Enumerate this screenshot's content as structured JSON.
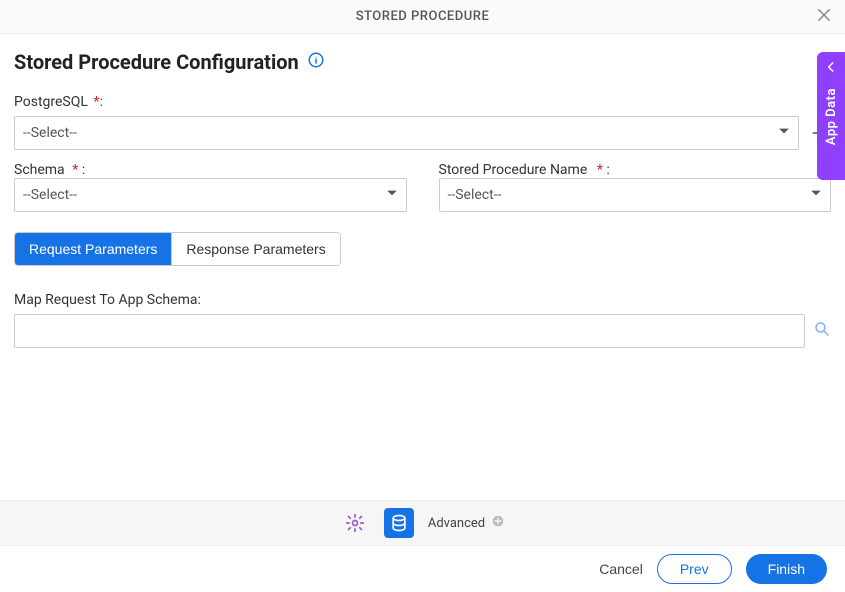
{
  "window": {
    "title": "STORED PROCEDURE"
  },
  "page": {
    "title": "Stored Procedure Configuration"
  },
  "form": {
    "db_label": "PostgreSQL",
    "db_select": "--Select--",
    "schema_label": "Schema",
    "schema_select": "--Select--",
    "sp_name_label": "Stored Procedure Name",
    "sp_name_select": "--Select--",
    "required_mark": "*",
    "colon": ":",
    "req_colon_space": " :",
    "req_colon_tight": "*:"
  },
  "tabs": {
    "request": "Request Parameters",
    "response": "Response Parameters"
  },
  "map": {
    "label": "Map Request To App Schema:",
    "value": ""
  },
  "toolbar": {
    "advanced": "Advanced"
  },
  "footer": {
    "cancel": "Cancel",
    "prev": "Prev",
    "finish": "Finish"
  },
  "sidepanel": {
    "label": "App Data"
  }
}
